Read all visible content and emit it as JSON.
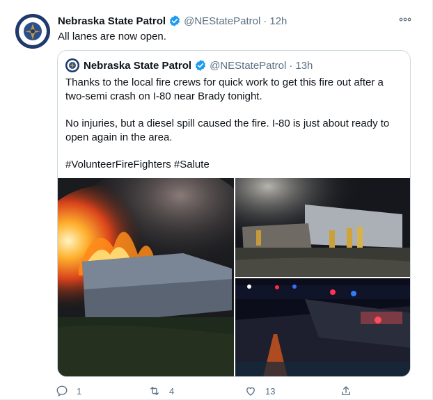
{
  "tweet": {
    "author_name": "Nebraska State Patrol",
    "handle": "@NEStatePatrol",
    "separator": "·",
    "time": "12h",
    "text": "All lanes are now open.",
    "avatar_icon": "state-patrol-seal-icon",
    "colors": {
      "verified": "#1d9bf0",
      "muted": "#5b7083",
      "border": "#cfd9de"
    }
  },
  "quoted": {
    "author_name": "Nebraska State Patrol",
    "handle": "@NEStatePatrol",
    "separator": "·",
    "time": "13h",
    "paragraphs": [
      "Thanks to the local fire crews for quick work to get this fire out after a two-semi crash on I-80 near Brady tonight.",
      "No injuries, but a diesel spill caused the fire. I-80 is just about ready to open again in the area.",
      "#VolunteerFireFighters #Salute"
    ],
    "images": [
      {
        "icon": "truck-fire-photo"
      },
      {
        "icon": "firefighters-at-semi-photo"
      },
      {
        "icon": "emergency-vehicles-night-photo"
      }
    ]
  },
  "actions": {
    "reply_count": "1",
    "retweet_count": "4",
    "like_count": "13"
  }
}
